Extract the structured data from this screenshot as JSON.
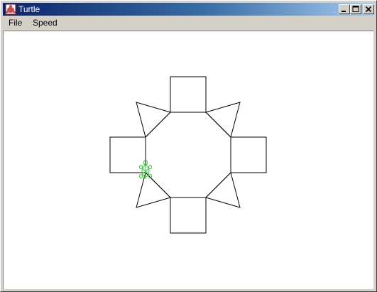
{
  "window": {
    "title": "Turtle",
    "icon": "turtle-app-icon",
    "buttons": [
      "minimize-icon",
      "maximize-icon",
      "close-icon"
    ]
  },
  "menubar": {
    "items": [
      {
        "label": "File"
      },
      {
        "label": "Speed"
      }
    ]
  },
  "canvas": {
    "background": "#ffffff",
    "stroke_color": "#000000",
    "turtle_color": "#33cc33",
    "turtle_icon": "turtle-icon"
  },
  "colors": {
    "titlebar_start": "#0a246a",
    "titlebar_end": "#a6caf0",
    "chrome": "#d4d0c8"
  }
}
